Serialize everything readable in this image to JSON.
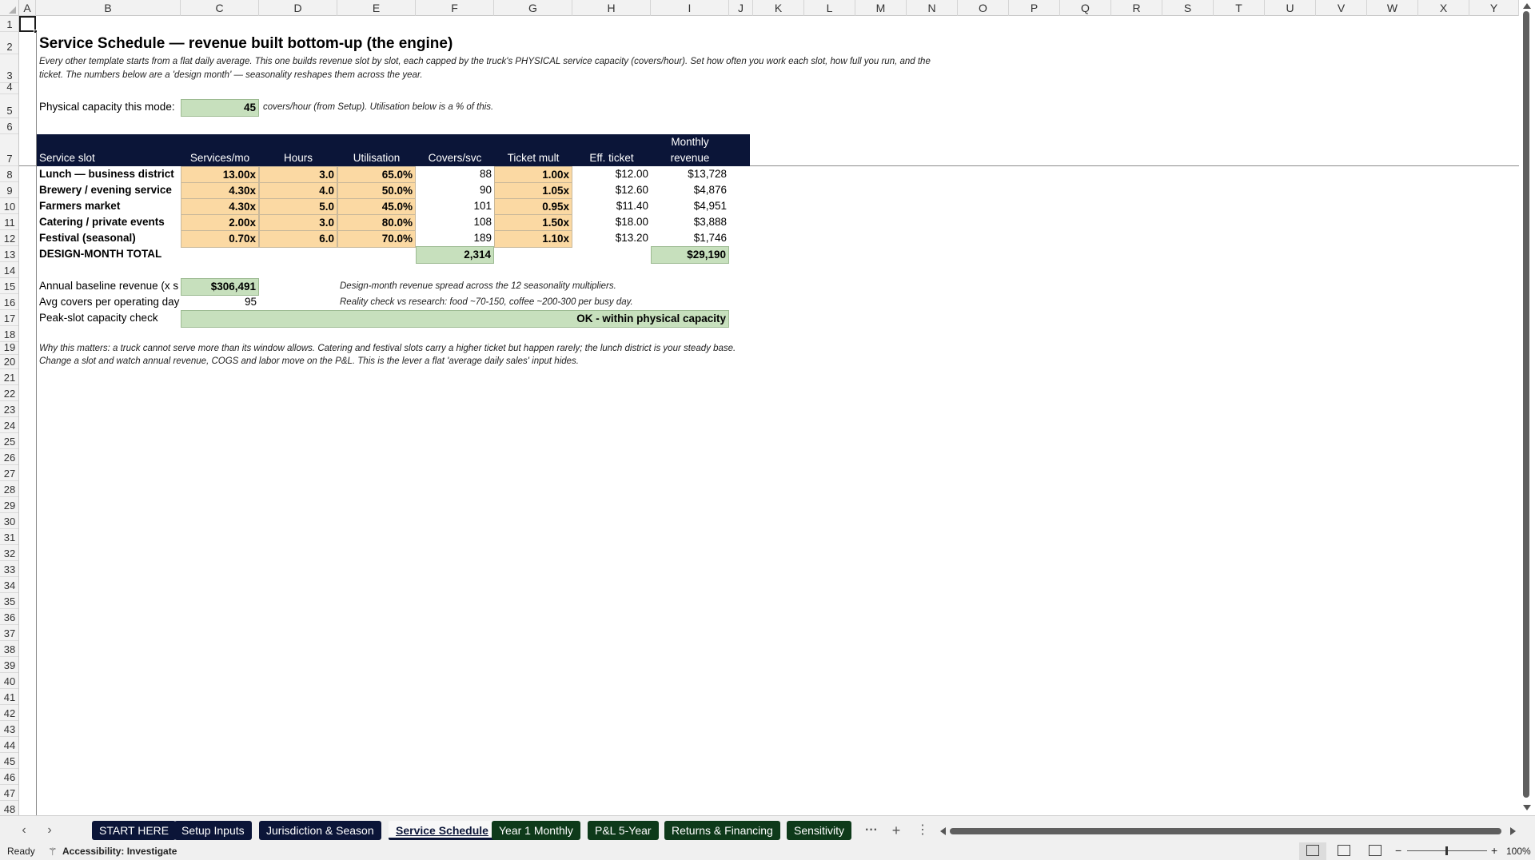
{
  "columns": [
    "A",
    "B",
    "C",
    "D",
    "E",
    "F",
    "G",
    "H",
    "I",
    "J",
    "K",
    "L",
    "M",
    "N",
    "O",
    "P",
    "Q",
    "R",
    "S",
    "T",
    "U",
    "V",
    "W",
    "X",
    "Y"
  ],
  "rows": [
    "1",
    "2",
    "3",
    "4",
    "5",
    "6",
    "7",
    "8",
    "9",
    "10",
    "11",
    "12",
    "13",
    "14",
    "15",
    "16",
    "17",
    "18",
    "19",
    "20",
    "21",
    "22",
    "23",
    "24",
    "25",
    "26",
    "27",
    "28",
    "29",
    "30",
    "31",
    "32",
    "33",
    "34",
    "35",
    "36",
    "37",
    "38",
    "39",
    "40",
    "41",
    "42",
    "43",
    "44",
    "45",
    "46",
    "47",
    "48"
  ],
  "sheet": {
    "title": "Service Schedule — revenue built bottom-up (the engine)",
    "intro_line1": "Every other template starts from a flat daily average. This one builds revenue slot by slot, each capped by the truck's PHYSICAL service capacity (covers/hour). Set how often you work each slot, how full you run, and the",
    "intro_line2": "ticket. The numbers below are a 'design month' — seasonality reshapes them across the year.",
    "capacity_label": "Physical capacity this mode:",
    "capacity_value": "45",
    "capacity_note": "covers/hour (from Setup). Utilisation below is a % of this.",
    "headers": {
      "slot": "Service slot",
      "services": "Services/mo",
      "hours": "Hours",
      "util": "Utilisation",
      "covers": "Covers/svc",
      "mult": "Ticket mult",
      "eff": "Eff. ticket",
      "rev1": "Monthly",
      "rev2": "revenue"
    },
    "slots": [
      {
        "name": "Lunch — business district",
        "services": "13.00x",
        "hours": "3.0",
        "util": "65.0%",
        "covers": "88",
        "mult": "1.00x",
        "eff": "$12.00",
        "rev": "$13,728"
      },
      {
        "name": "Brewery / evening service",
        "services": "4.30x",
        "hours": "4.0",
        "util": "50.0%",
        "covers": "90",
        "mult": "1.05x",
        "eff": "$12.60",
        "rev": "$4,876"
      },
      {
        "name": "Farmers market",
        "services": "4.30x",
        "hours": "5.0",
        "util": "45.0%",
        "covers": "101",
        "mult": "0.95x",
        "eff": "$11.40",
        "rev": "$4,951"
      },
      {
        "name": "Catering / private events",
        "services": "2.00x",
        "hours": "3.0",
        "util": "80.0%",
        "covers": "108",
        "mult": "1.50x",
        "eff": "$18.00",
        "rev": "$3,888"
      },
      {
        "name": "Festival (seasonal)",
        "services": "0.70x",
        "hours": "6.0",
        "util": "70.0%",
        "covers": "189",
        "mult": "1.10x",
        "eff": "$13.20",
        "rev": "$1,746"
      }
    ],
    "total_label": "DESIGN-MONTH TOTAL",
    "total_covers": "2,314",
    "total_rev": "$29,190",
    "annual_label": "Annual baseline revenue (x s",
    "annual_value": "$306,491",
    "annual_note": "Design-month revenue spread across the 12 seasonality multipliers.",
    "avg_label": "Avg covers per operating day",
    "avg_value": "95",
    "avg_note": "Reality check vs research: food ~70-150, coffee ~200-300 per busy day.",
    "peak_label": "Peak-slot capacity check",
    "peak_value": "OK - within physical capacity",
    "why_line1": "Why this matters: a truck cannot serve more than its window allows. Catering and festival slots carry a higher ticket but happen rarely; the lunch district is your steady base.",
    "why_line2": "Change a slot and watch annual revenue, COGS and labor move on the P&L. This is the lever a flat 'average daily sales' input hides."
  },
  "tabs": {
    "start": "START HERE",
    "setup": "Setup Inputs",
    "juris": "Jurisdiction & Season",
    "service": "Service Schedule",
    "year1": "Year 1 Monthly",
    "pl": "P&L 5-Year",
    "returns": "Returns & Financing",
    "sens": "Sensitivity",
    "more": "···",
    "add": "+",
    "menu": "⋮"
  },
  "status": {
    "ready": "Ready",
    "accessibility": "Accessibility: Investigate",
    "zoom": "100%"
  },
  "colors": {
    "navy": "#0b1538",
    "input": "#fbd9a3",
    "output": "#c7e0bd",
    "green_tab": "#0e3a1a"
  }
}
